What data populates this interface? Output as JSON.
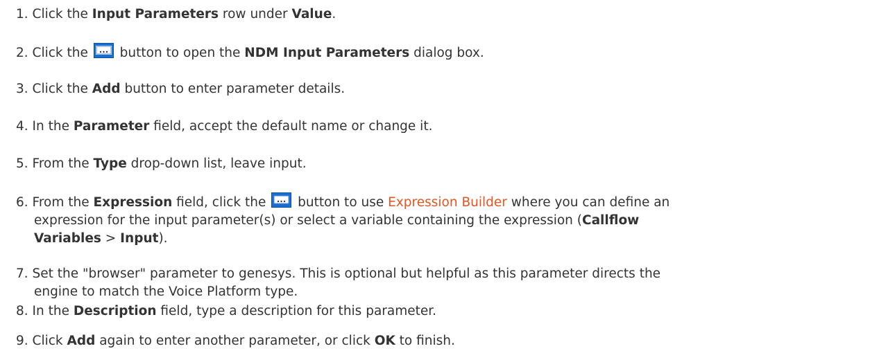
{
  "steps": [
    {
      "num": "1.",
      "parts": [
        "Click the ",
        "Input Parameters",
        " row under ",
        "Value",
        "."
      ]
    },
    {
      "num": "2.",
      "parts": [
        "Click the ",
        " button to open the ",
        "NDM Input Parameters",
        " dialog box."
      ],
      "icon": "ellipsis-button-icon"
    },
    {
      "num": "3.",
      "parts": [
        "Click the ",
        "Add",
        " button to enter parameter details."
      ]
    },
    {
      "num": "4.",
      "parts": [
        "In the ",
        "Parameter",
        " field, accept the default name or change it."
      ]
    },
    {
      "num": "5.",
      "parts": [
        "From the ",
        "Type",
        " drop-down list, leave input."
      ]
    },
    {
      "num": "6.",
      "parts": [
        "From the ",
        "Expression",
        " field, click the ",
        " button to use ",
        "Expression Builder",
        " where you can define an",
        "expression for the input parameter(s) or select a variable containing the expression (",
        "Callflow",
        "Variables",
        " > ",
        "Input",
        ")."
      ],
      "icon": "ellipsis-button-icon"
    },
    {
      "num": "7.",
      "parts": [
        "Set the \"browser\" parameter to ",
        "genesys",
        ". This is optional but helpful as this parameter directs the",
        "engine to match the Voice Platform type."
      ]
    },
    {
      "num": "8.",
      "parts": [
        "In the ",
        "Description",
        " field, type a description for this parameter."
      ]
    },
    {
      "num": "9.",
      "parts": [
        "Click ",
        "Add",
        " again to enter another parameter, or click ",
        "OK",
        " to finish."
      ]
    }
  ],
  "colors": {
    "text": "#333333",
    "link": "#e8531f",
    "icon_bg": "#1a6fd1"
  }
}
